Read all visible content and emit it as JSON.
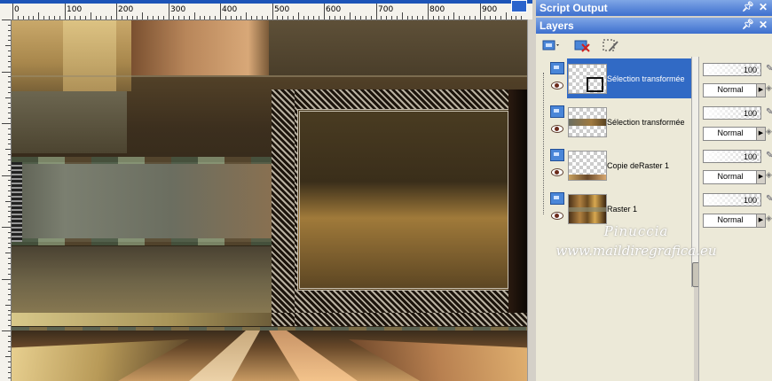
{
  "ruler": {
    "labels": [
      "0",
      "100",
      "200",
      "300",
      "400",
      "500",
      "600",
      "700",
      "800",
      "900"
    ]
  },
  "panels": {
    "script_output": {
      "title": "Script Output",
      "pin_icon": "pin-icon",
      "close_icon": "close-icon"
    },
    "layers": {
      "title": "Layers",
      "pin_icon": "pin-icon",
      "close_icon": "close-icon"
    }
  },
  "toolbar": {
    "buttons": [
      "new-layer-icon",
      "delete-layer-icon",
      "edit-selection-icon"
    ]
  },
  "layers": [
    {
      "name": "Sélection transformée",
      "opacity": "100",
      "blend": "Normal",
      "selected": true
    },
    {
      "name": "Sélection transformée",
      "opacity": "100",
      "blend": "Normal",
      "selected": false
    },
    {
      "name": "Copie deRaster 1",
      "opacity": "100",
      "blend": "Normal",
      "selected": false
    },
    {
      "name": "Raster 1",
      "opacity": "100",
      "blend": "Normal",
      "selected": false
    }
  ],
  "watermark": {
    "line1": "Pinuccia",
    "line2": "www.maildiregrafica.eu"
  },
  "colors": {
    "titlebar": "#3d6fce",
    "selection": "#316ac5",
    "panel_bg": "#ece9d8"
  }
}
